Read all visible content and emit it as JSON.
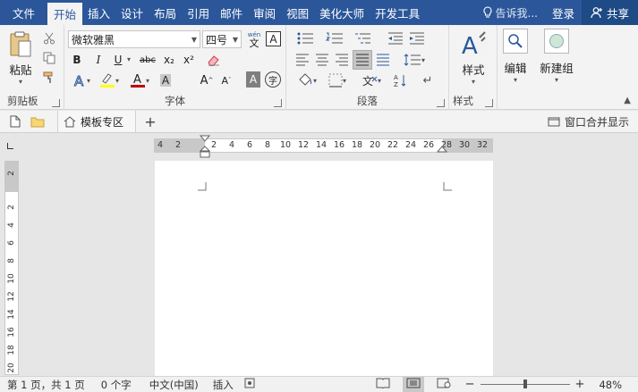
{
  "menu": {
    "tabs": [
      "文件",
      "开始",
      "插入",
      "设计",
      "布局",
      "引用",
      "邮件",
      "审阅",
      "视图",
      "美化大师",
      "开发工具"
    ],
    "active_index": 1,
    "tell_me": "告诉我...",
    "login": "登录",
    "share": "共享"
  },
  "ribbon": {
    "clipboard": {
      "label": "剪贴板",
      "paste": "粘贴"
    },
    "font": {
      "label": "字体",
      "font_name": "微软雅黑",
      "font_size": "四号",
      "wen_label": "wén",
      "wen_char": "文",
      "border_char": "A",
      "bold": "B",
      "italic": "I",
      "underline": "U",
      "strike": "abc",
      "sub": "x₂",
      "sup": "x²",
      "grow": "A",
      "shrink": "A",
      "shade": "A",
      "circle": "字",
      "highlight_color": "#ffff00",
      "font_color": "#c00000"
    },
    "paragraph": {
      "label": "段落"
    },
    "styles": {
      "label": "样式",
      "button": "样式"
    },
    "editing": {
      "button": "编辑"
    },
    "new_group": {
      "button": "新建组"
    }
  },
  "tabstrip": {
    "template_tab": "模板专区",
    "merge": "窗口合并显示"
  },
  "ruler": {
    "h_ticks": [
      "4",
      "2",
      "2",
      "4",
      "6",
      "8",
      "10",
      "12",
      "14",
      "16",
      "18",
      "20",
      "22",
      "24",
      "26",
      "28",
      "30",
      "32"
    ],
    "v_ticks": [
      "2",
      "2",
      "4",
      "6",
      "8",
      "10",
      "12",
      "14",
      "16",
      "18",
      "20"
    ]
  },
  "status": {
    "page": "第 1 页，共 1 页",
    "words": "0 个字",
    "language": "中文(中国)",
    "mode": "插入",
    "zoom": "48%",
    "minus": "−",
    "plus": "+"
  },
  "colors": {
    "brand": "#2b579a"
  }
}
